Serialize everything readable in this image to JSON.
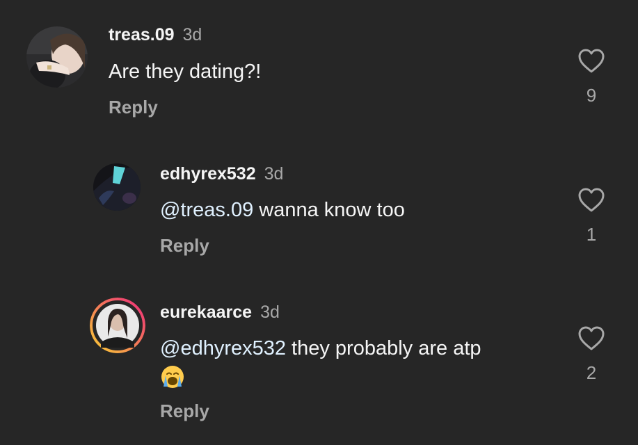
{
  "comments": [
    {
      "username": "treas.09",
      "time": "3d",
      "text": "Are they dating?!",
      "reply_label": "Reply",
      "likes": "9"
    },
    {
      "username": "edhyrex532",
      "time": "3d",
      "mention": "@treas.09",
      "text": " wanna know too",
      "reply_label": "Reply",
      "likes": "1"
    },
    {
      "username": "eurekaarce",
      "time": "3d",
      "mention": "@edhyrex532",
      "text": " they probably are atp",
      "emoji": "loudly-crying-face",
      "reply_label": "Reply",
      "likes": "2"
    }
  ],
  "colors": {
    "background": "#262626",
    "text": "#f5f5f5",
    "secondary": "#a8a8a8",
    "mention": "#e0f1ff",
    "story_ring_start": "#f9ce34",
    "story_ring_end": "#ee2a7b"
  }
}
